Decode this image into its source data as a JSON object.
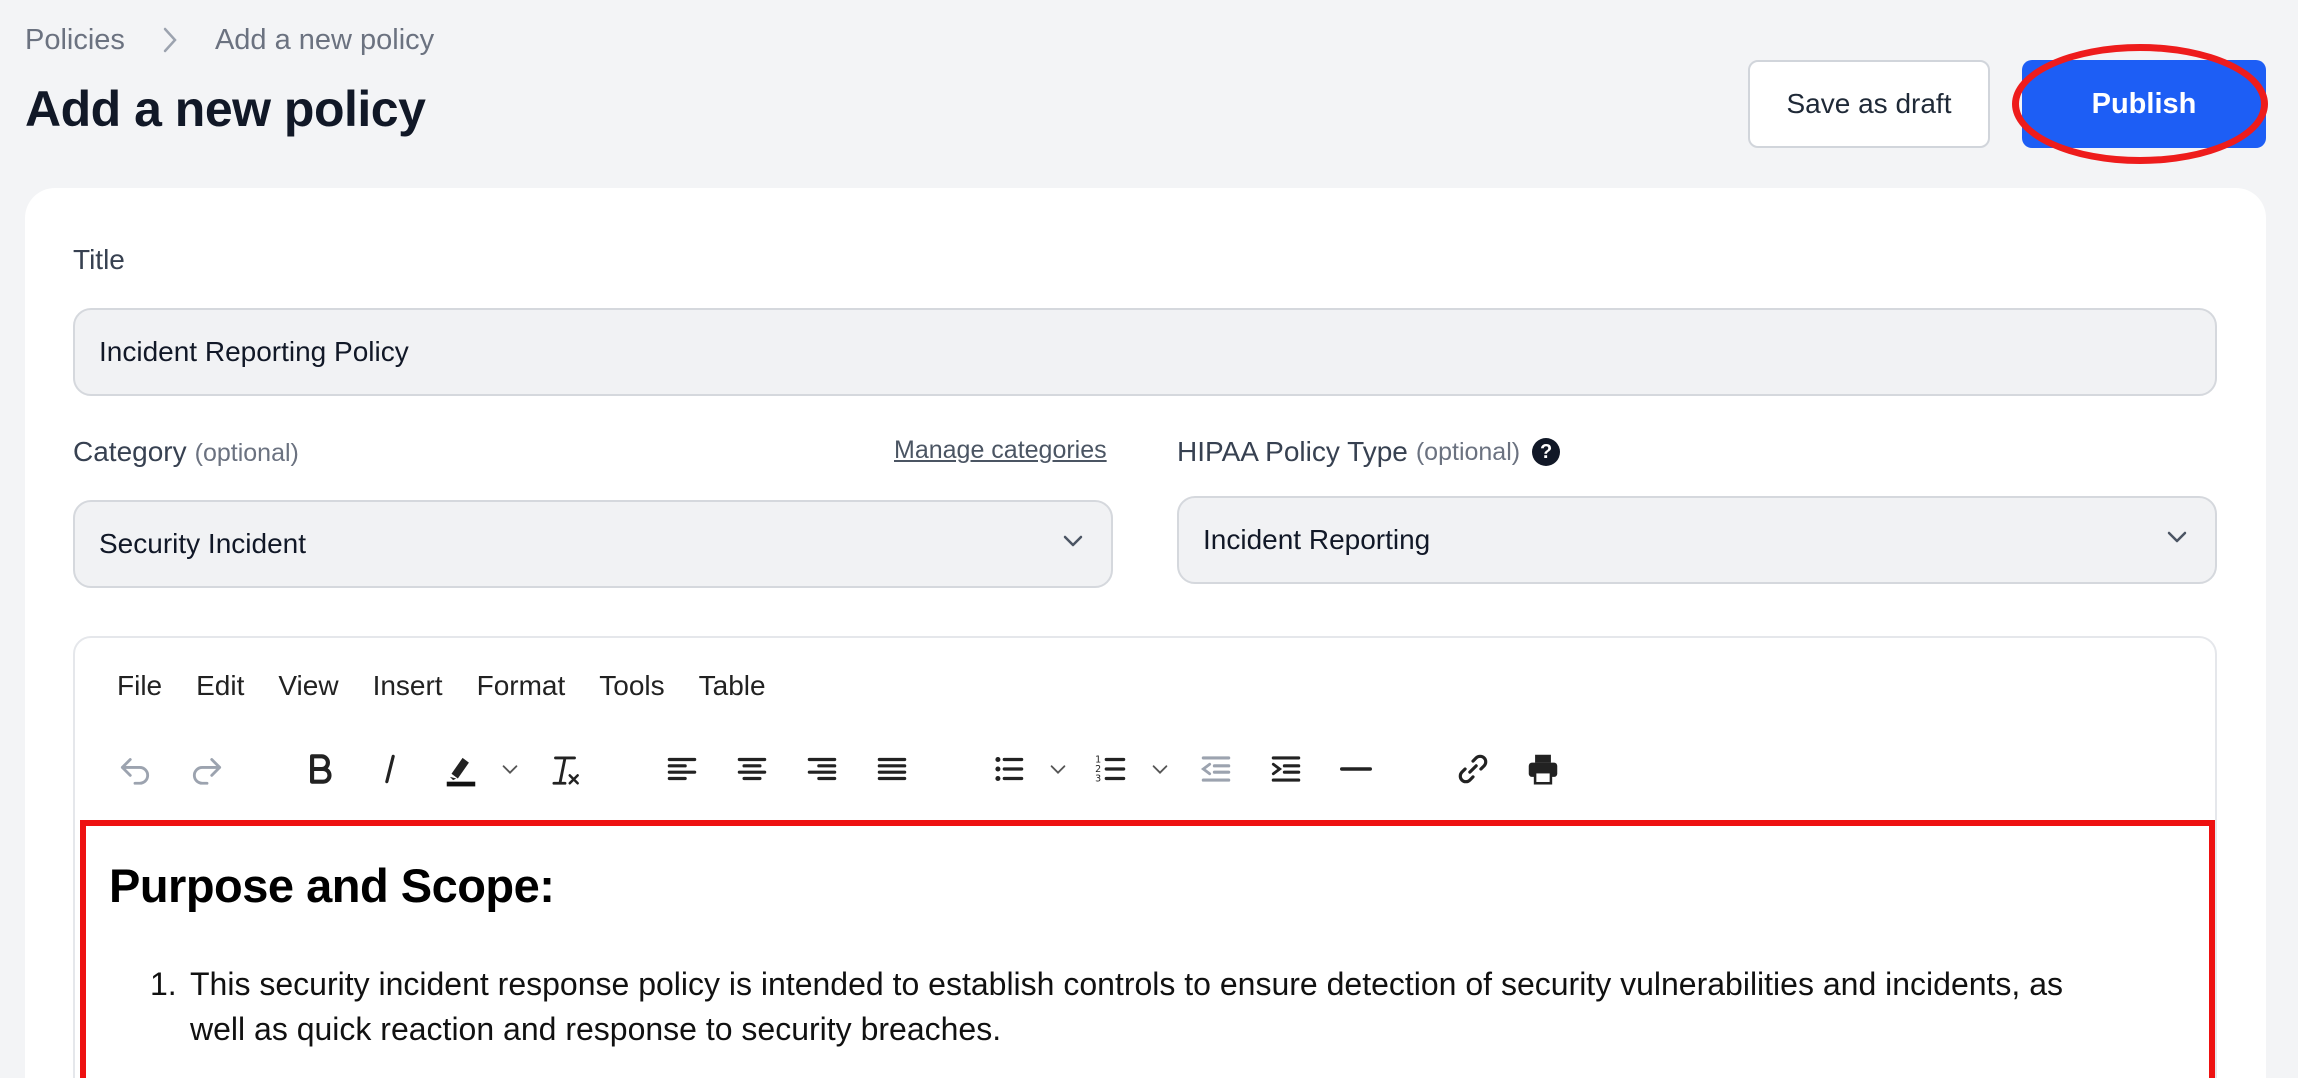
{
  "breadcrumb": {
    "root": "Policies",
    "current": "Add a new policy"
  },
  "page": {
    "title": "Add a new policy"
  },
  "actions": {
    "draft_label": "Save as draft",
    "publish_label": "Publish"
  },
  "form": {
    "title_label": "Title",
    "title_value": "Incident Reporting Policy",
    "category_label": "Category",
    "category_optional": "(optional)",
    "manage_categories": "Manage categories",
    "category_value": "Security Incident",
    "hipaa_label": "HIPAA Policy Type",
    "hipaa_optional": "(optional)",
    "hipaa_help": "?",
    "hipaa_value": "Incident Reporting"
  },
  "editor": {
    "menu": [
      "File",
      "Edit",
      "View",
      "Insert",
      "Format",
      "Tools",
      "Table"
    ],
    "toolbar_icons": [
      "undo-icon",
      "redo-icon",
      "bold-icon",
      "italic-icon",
      "highlight-icon",
      "clear-format-icon",
      "align-left-icon",
      "align-center-icon",
      "align-right-icon",
      "justify-icon",
      "bullet-list-icon",
      "numbered-list-icon",
      "outdent-icon",
      "indent-icon",
      "horizontal-rule-icon",
      "link-icon",
      "print-icon"
    ],
    "heading": "Purpose and Scope:",
    "list_item_1_num": "1.",
    "list_item_1_line1": "This security incident response policy is intended to establish controls to ensure detection of security vulnerabilities and incidents, as",
    "list_item_1_line2": "well as quick reaction and response to security breaches."
  },
  "colors": {
    "primary": "#1d5ef5",
    "annotation": "#ee1111",
    "background": "#f3f4f6"
  }
}
